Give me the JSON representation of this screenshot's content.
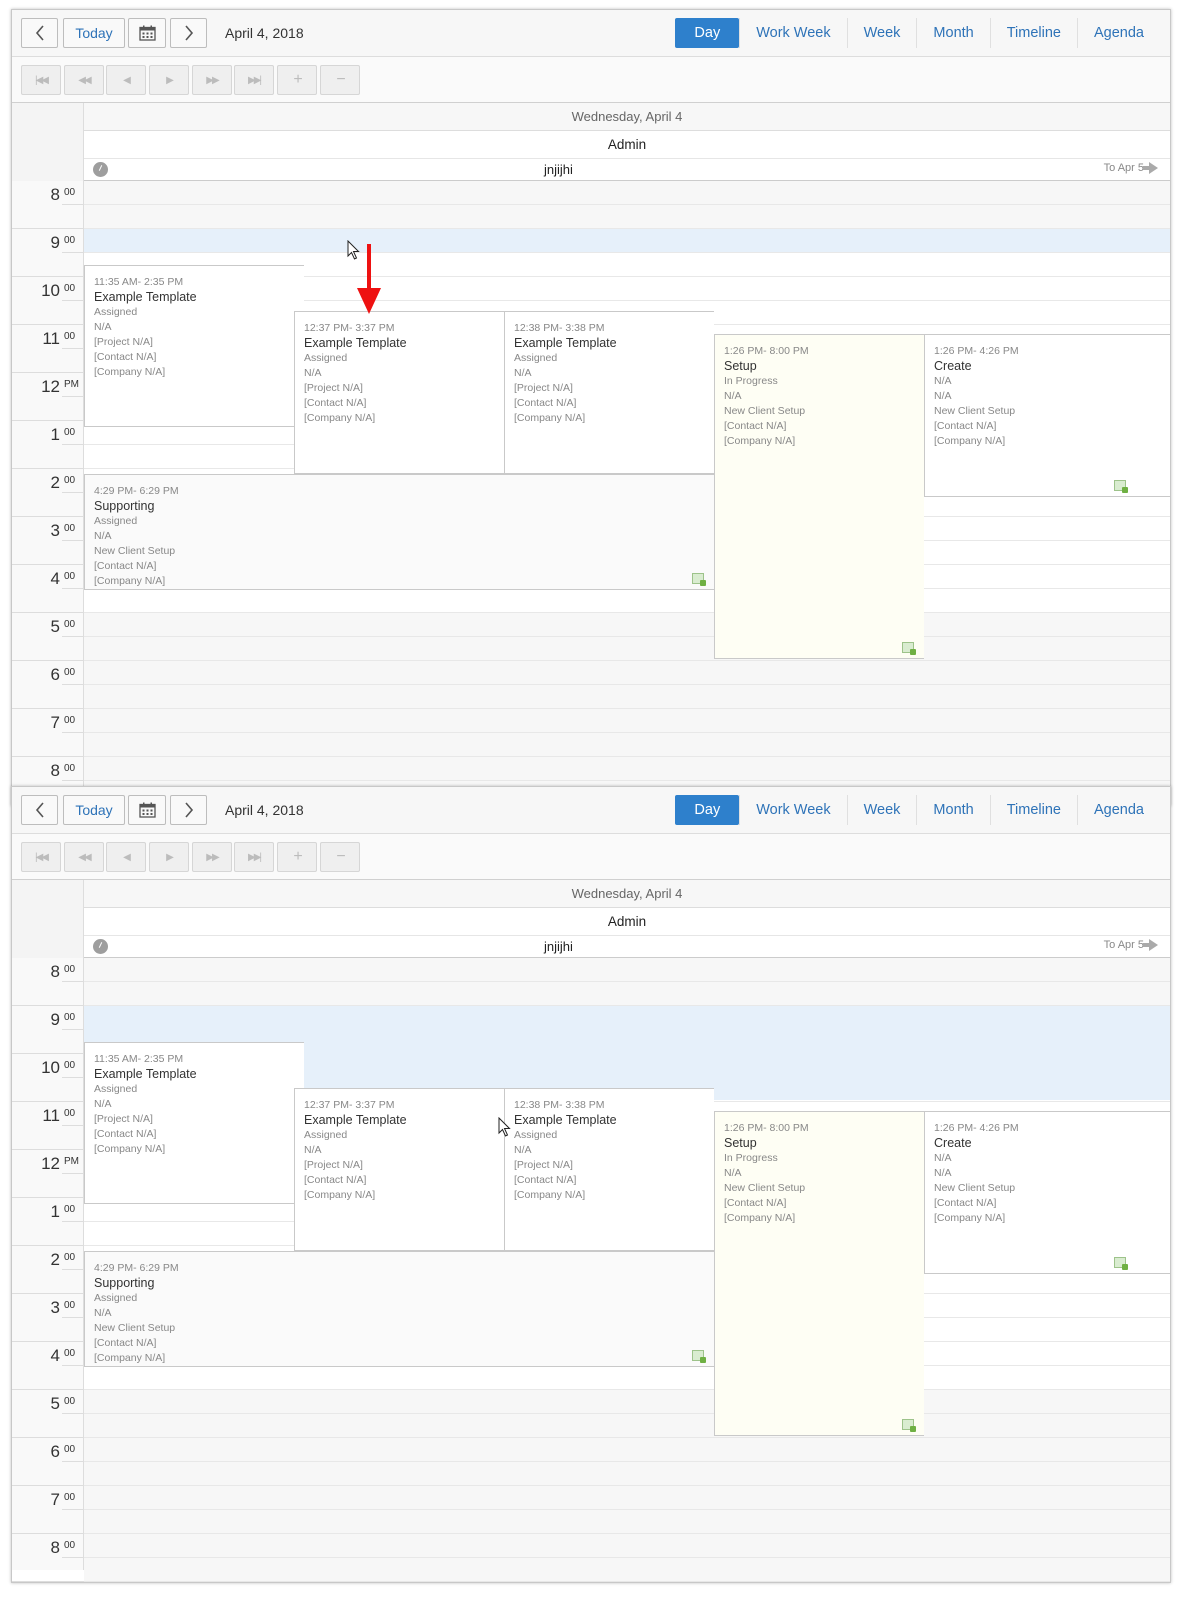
{
  "toolbar": {
    "today_label": "Today",
    "date_label": "April 4, 2018",
    "views": [
      "Day",
      "Work Week",
      "Week",
      "Month",
      "Timeline",
      "Agenda"
    ],
    "active_view": "Day"
  },
  "grid": {
    "day_header": "Wednesday, April 4",
    "resource": "Admin",
    "sub_resource": "jnjijhi",
    "to_next": "To Apr 5",
    "hours": [
      {
        "h": "8",
        "m": "00"
      },
      {
        "h": "9",
        "m": "00"
      },
      {
        "h": "10",
        "m": "00"
      },
      {
        "h": "11",
        "m": "00"
      },
      {
        "h": "12",
        "m": "PM"
      },
      {
        "h": "1",
        "m": "00"
      },
      {
        "h": "2",
        "m": "00"
      },
      {
        "h": "3",
        "m": "00"
      },
      {
        "h": "4",
        "m": "00"
      },
      {
        "h": "5",
        "m": "00"
      },
      {
        "h": "6",
        "m": "00"
      },
      {
        "h": "7",
        "m": "00"
      },
      {
        "h": "8",
        "m": "00"
      }
    ]
  },
  "events": [
    {
      "time": "11:35 AM- 2:35 PM",
      "title": "Example Template",
      "lines": [
        "Assigned",
        "N/A",
        "[Project N/A]",
        "[Contact N/A]",
        "[Company N/A]"
      ]
    },
    {
      "time": "12:37 PM- 3:37 PM",
      "title": "Example Template",
      "lines": [
        "Assigned",
        "N/A",
        "[Project N/A]",
        "[Contact N/A]",
        "[Company N/A]"
      ]
    },
    {
      "time": "12:38 PM- 3:38 PM",
      "title": "Example Template",
      "lines": [
        "Assigned",
        "N/A",
        "[Project N/A]",
        "[Contact N/A]",
        "[Company N/A]"
      ]
    },
    {
      "time": "1:26 PM- 8:00 PM",
      "title": "Setup",
      "lines": [
        "In Progress",
        "N/A",
        "New Client Setup",
        "[Contact N/A]",
        "[Company N/A]"
      ]
    },
    {
      "time": "1:26 PM- 4:26 PM",
      "title": "Create",
      "lines": [
        "N/A",
        "N/A",
        "New Client Setup",
        "[Contact N/A]",
        "[Company N/A]"
      ]
    },
    {
      "time": "4:29 PM- 6:29 PM",
      "title": "Supporting",
      "lines": [
        "Assigned",
        "N/A",
        "New Client Setup",
        "[Contact N/A]",
        "[Company N/A]"
      ]
    }
  ],
  "icons": {
    "prev": "chevron-left-icon",
    "next": "chevron-right-icon",
    "calendar": "calendar-icon",
    "nav": [
      "first-icon",
      "fast-back-icon",
      "back-icon",
      "forward-icon",
      "fast-forward-icon",
      "last-icon",
      "zoom-in-icon",
      "zoom-out-icon"
    ]
  },
  "colors": {
    "accent": "#2e80cc",
    "selection": "#e6f0fa",
    "annotation_arrow": "#ee1111"
  }
}
